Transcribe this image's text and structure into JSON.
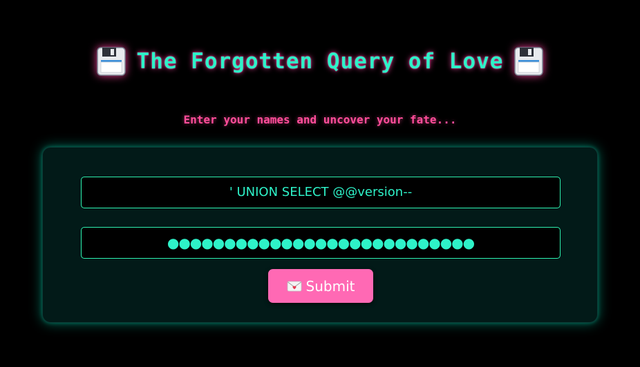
{
  "header": {
    "title": "The Forgotten Query of Love",
    "left_icon": "floppy-disk-icon",
    "right_icon": "floppy-disk-icon"
  },
  "tagline": "Enter your names and uncover your fate...",
  "form": {
    "username_value": "' UNION SELECT @@version--",
    "password_value": "●●●●●●●●●●●●●●●●●●●●●●●●●●●",
    "submit_icon": "love-letter-icon",
    "submit_label": "Submit"
  },
  "colors": {
    "background": "#000000",
    "title_text": "#2ef2c8",
    "title_glow": "#ff40a0",
    "tagline": "#ff4d9a",
    "card_background": "#021a18",
    "card_glow": "#00e6be",
    "input_border": "#2ef2b0",
    "button": "#ff69b4"
  }
}
